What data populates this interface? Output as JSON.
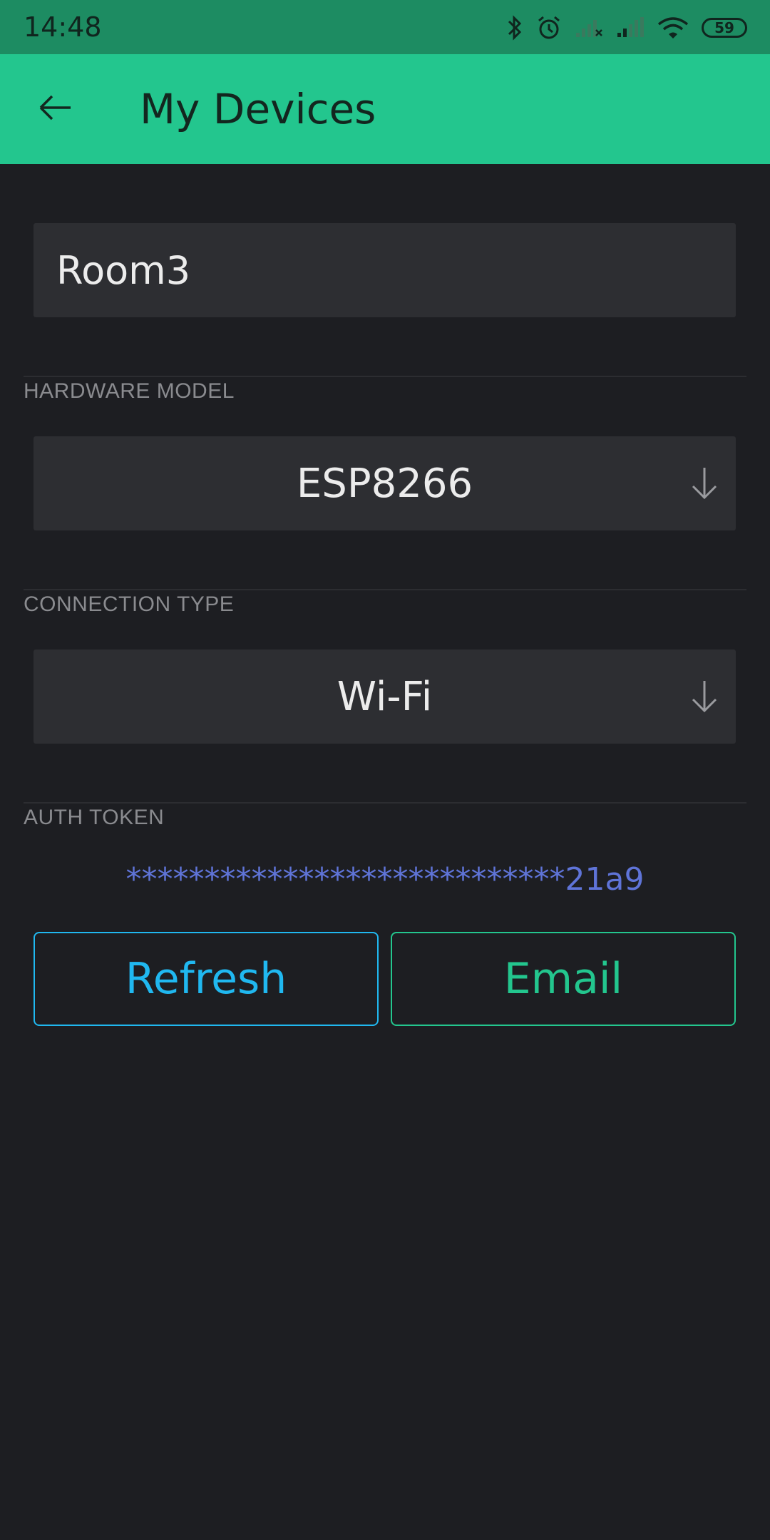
{
  "status_bar": {
    "time": "14:48",
    "battery": "59",
    "icons": [
      "bluetooth-icon",
      "alarm-icon",
      "signal-none-icon",
      "signal-icon",
      "wifi-icon",
      "battery-icon"
    ]
  },
  "app_bar": {
    "title": "My Devices",
    "back_icon": "arrow-left-icon"
  },
  "device": {
    "name": "Room3"
  },
  "hardware_model": {
    "label": "HARDWARE MODEL",
    "value": "ESP8266"
  },
  "connection_type": {
    "label": "CONNECTION TYPE",
    "value": "Wi-Fi"
  },
  "auth_token": {
    "label": "AUTH TOKEN",
    "value": "****************************21a9"
  },
  "actions": {
    "refresh_label": "Refresh",
    "email_label": "Email"
  },
  "colors": {
    "status_bar": "#1d8c62",
    "app_bar": "#23c68e",
    "background": "#1d1e22",
    "field": "#2d2e32",
    "refresh": "#20b8f0",
    "email": "#23c68e",
    "token": "#5f74d8"
  }
}
